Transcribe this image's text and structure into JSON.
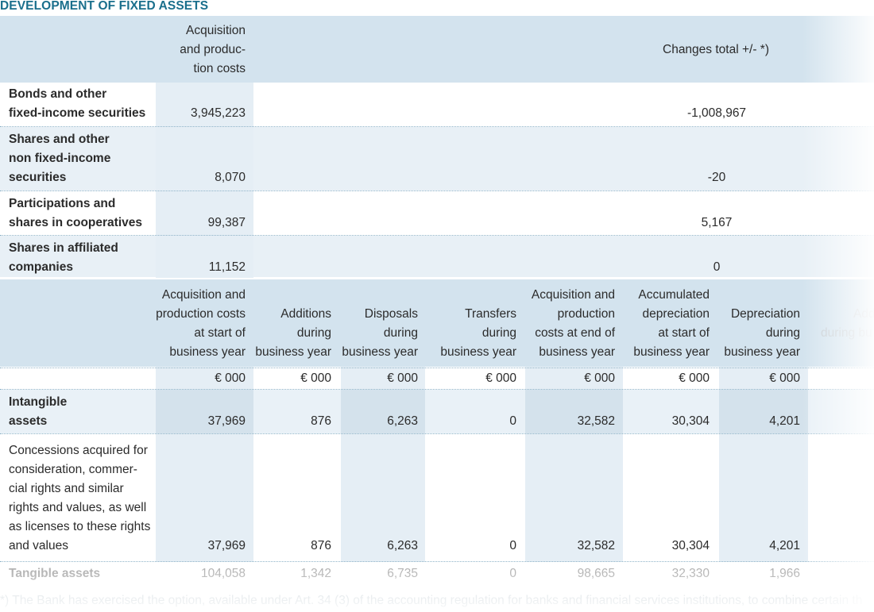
{
  "title": "DEVELOPMENT OF FIXED ASSETS",
  "top_table": {
    "headers": {
      "acq_line1": "Acquisition",
      "acq_line2": "and produc-",
      "acq_line3": "tion costs",
      "changes": "Changes total +/- *)"
    },
    "rows": [
      {
        "label_line1": "Bonds and other",
        "label_line2": "fixed-income securities",
        "label_line3": "",
        "acq": "3,945,223",
        "changes": "-1,008,967"
      },
      {
        "label_line1": "Shares and other",
        "label_line2": "non fixed-income",
        "label_line3": "securities",
        "acq": "8,070",
        "changes": "-20"
      },
      {
        "label_line1": "Participations and",
        "label_line2": "shares in cooperatives",
        "label_line3": "",
        "acq": "99,387",
        "changes": "5,167"
      },
      {
        "label_line1": "Shares in affiliated",
        "label_line2": "companies",
        "label_line3": "",
        "acq": "11,152",
        "changes": "0"
      }
    ]
  },
  "bottom_table": {
    "headers": {
      "c1": [
        "Acquisition and",
        "production costs",
        "at start of",
        "business year"
      ],
      "c2": [
        "Additions",
        "during",
        "business year"
      ],
      "c3": [
        "Disposals",
        "during",
        "business year"
      ],
      "c4": [
        "Transfers",
        "during",
        "business year"
      ],
      "c5": [
        "Acquisition and",
        "production",
        "costs at end of",
        "business year"
      ],
      "c6": [
        "Accumulated",
        "depreciation",
        "at start of",
        "business year"
      ],
      "c7": [
        "Depreciation",
        "during",
        "business year"
      ],
      "c8": [
        "Add",
        "during bu"
      ]
    },
    "unit": "€ 000",
    "intangible": {
      "label_line1": "Intangible",
      "label_line2": "assets",
      "values": [
        "37,969",
        "876",
        "6,263",
        "0",
        "32,582",
        "30,304",
        "4,201"
      ]
    },
    "concessions": {
      "label_lines": [
        "Concessions acquired for",
        "consideration, commer-",
        "cial rights and similar",
        "rights and values, as well",
        "as licenses to these rights",
        "and values"
      ],
      "values": [
        "37,969",
        "876",
        "6,263",
        "0",
        "32,582",
        "30,304",
        "4,201"
      ]
    },
    "tangible": {
      "label": "Tangible assets",
      "values": [
        "104,058",
        "1,342",
        "6,735",
        "0",
        "98,665",
        "32,330",
        "1,966"
      ]
    }
  },
  "footnote": "*) The Bank has exercised the option, available under Art. 34 (3) of the accounting regulation for banks and financial services institutions, to combine certain th"
}
